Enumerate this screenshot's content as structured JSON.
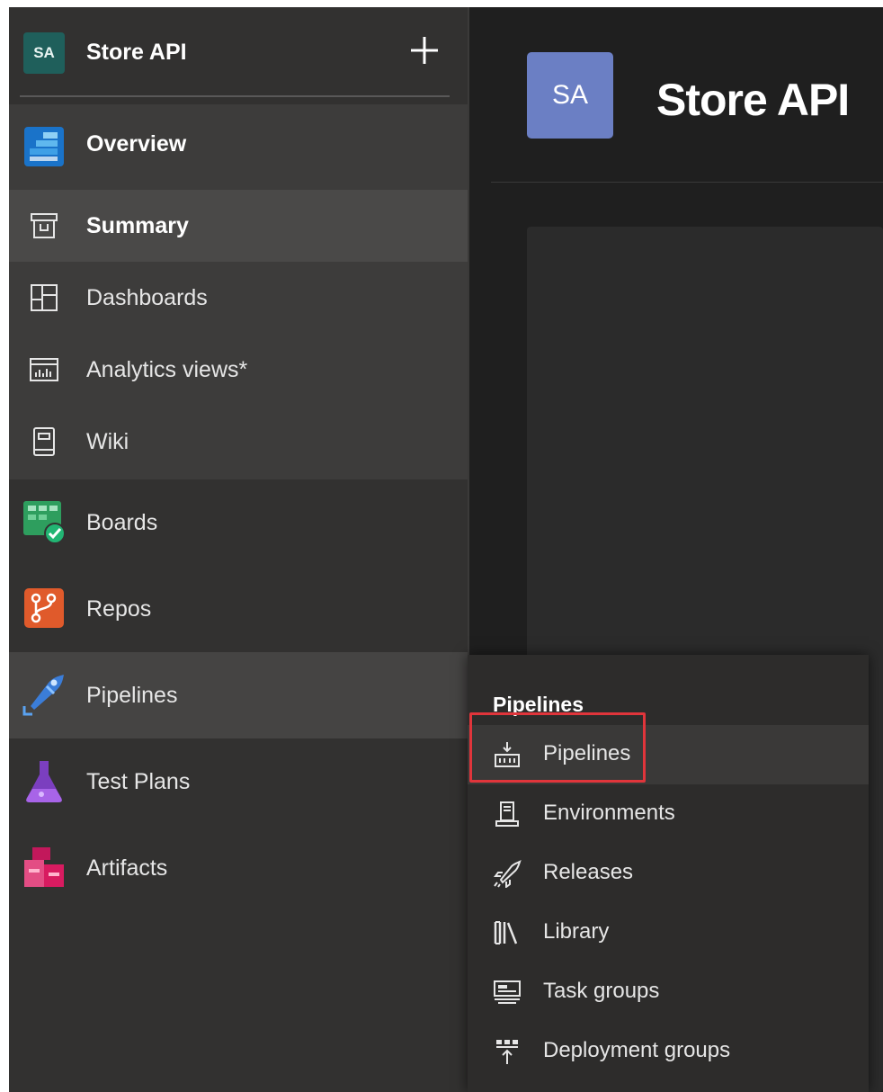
{
  "sidebar": {
    "project": {
      "initials": "SA",
      "name": "Store API",
      "add_icon": "plus-icon"
    },
    "items": [
      {
        "label": "Overview",
        "icon": "overview-icon"
      },
      {
        "label": "Summary",
        "icon": "summary-icon"
      },
      {
        "label": "Dashboards",
        "icon": "dashboards-icon"
      },
      {
        "label": "Analytics views*",
        "icon": "analytics-icon"
      },
      {
        "label": "Wiki",
        "icon": "wiki-icon"
      },
      {
        "label": "Boards",
        "icon": "boards-icon"
      },
      {
        "label": "Repos",
        "icon": "repos-icon"
      },
      {
        "label": "Pipelines",
        "icon": "pipelines-icon"
      },
      {
        "label": "Test Plans",
        "icon": "test-plans-icon"
      },
      {
        "label": "Artifacts",
        "icon": "artifacts-icon"
      }
    ]
  },
  "header": {
    "initials": "SA",
    "title": "Store API"
  },
  "flyout": {
    "title": "Pipelines",
    "items": [
      {
        "label": "Pipelines",
        "icon": "pipelines-build-icon"
      },
      {
        "label": "Environments",
        "icon": "environments-icon"
      },
      {
        "label": "Releases",
        "icon": "releases-rocket-icon"
      },
      {
        "label": "Library",
        "icon": "library-icon"
      },
      {
        "label": "Task groups",
        "icon": "task-groups-icon"
      },
      {
        "label": "Deployment groups",
        "icon": "deployment-groups-icon"
      }
    ]
  },
  "colors": {
    "sidebar_bg": "#323130",
    "selected_bg": "#4a4948",
    "project_badge": "#1f5f5b",
    "header_badge": "#6b7fc4",
    "highlight": "#e0353b"
  }
}
